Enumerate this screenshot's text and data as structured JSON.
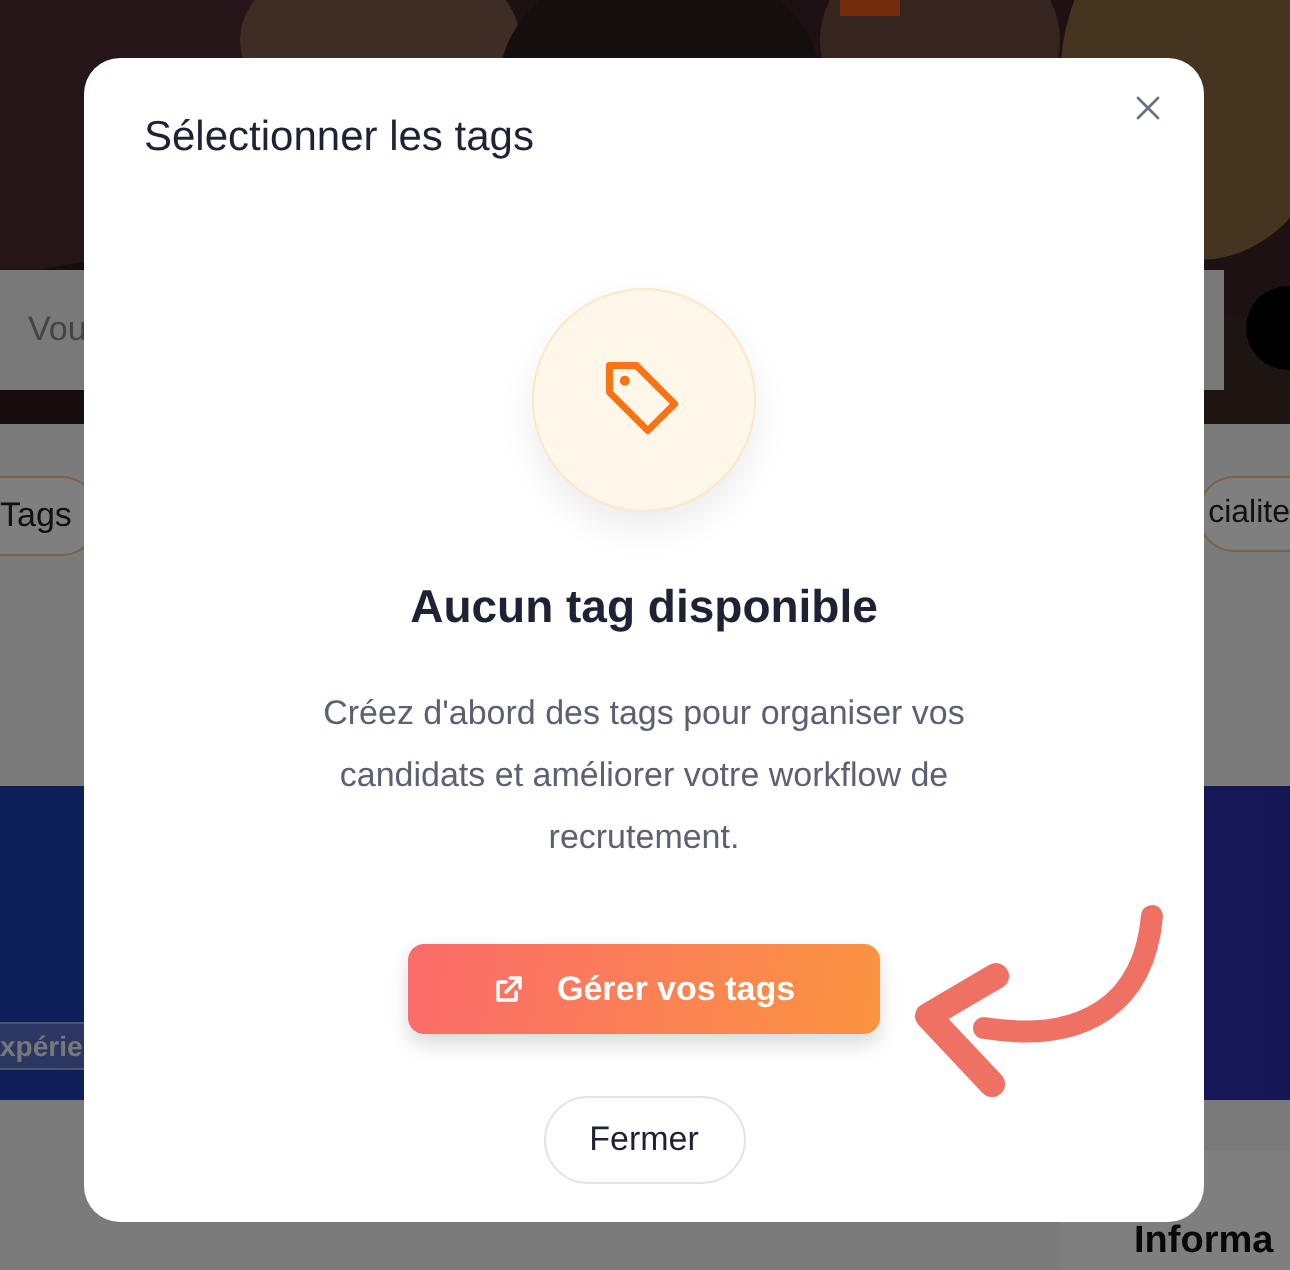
{
  "page": {
    "search": {
      "placeholder": "Vou"
    },
    "filters": [
      {
        "label": "Tags"
      },
      {
        "label": "cialite"
      }
    ],
    "banner": {
      "badge": "xpérie"
    },
    "section_heading": "Informa"
  },
  "dialog": {
    "title": "Sélectionner les tags",
    "empty_state": {
      "heading": "Aucun tag disponible",
      "message": "Créez d'abord des tags pour organiser vos candidats et améliorer votre workflow de recrutement."
    },
    "buttons": [
      {
        "label": "Gérer vos tags",
        "kind": "primary"
      },
      {
        "label": "Fermer",
        "kind": "secondary"
      }
    ]
  }
}
